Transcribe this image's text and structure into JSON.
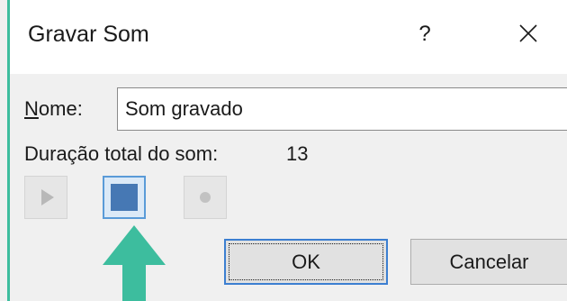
{
  "window": {
    "title": "Gravar Som",
    "help_label": "?",
    "close_icon": "close-icon"
  },
  "form": {
    "name_label_underlined": "N",
    "name_label_rest": "ome:",
    "name_value": "Som gravado",
    "duration_label": "Duração total do som:",
    "duration_value": "13"
  },
  "controls": {
    "play_icon": "play-icon",
    "stop_icon": "stop-icon",
    "record_icon": "record-icon"
  },
  "buttons": {
    "ok_label": "OK",
    "cancel_label": "Cancelar"
  },
  "colors": {
    "accent": "#3dbd9e",
    "stop_fill": "#4678b4",
    "focus_border": "#3c7fd1"
  }
}
